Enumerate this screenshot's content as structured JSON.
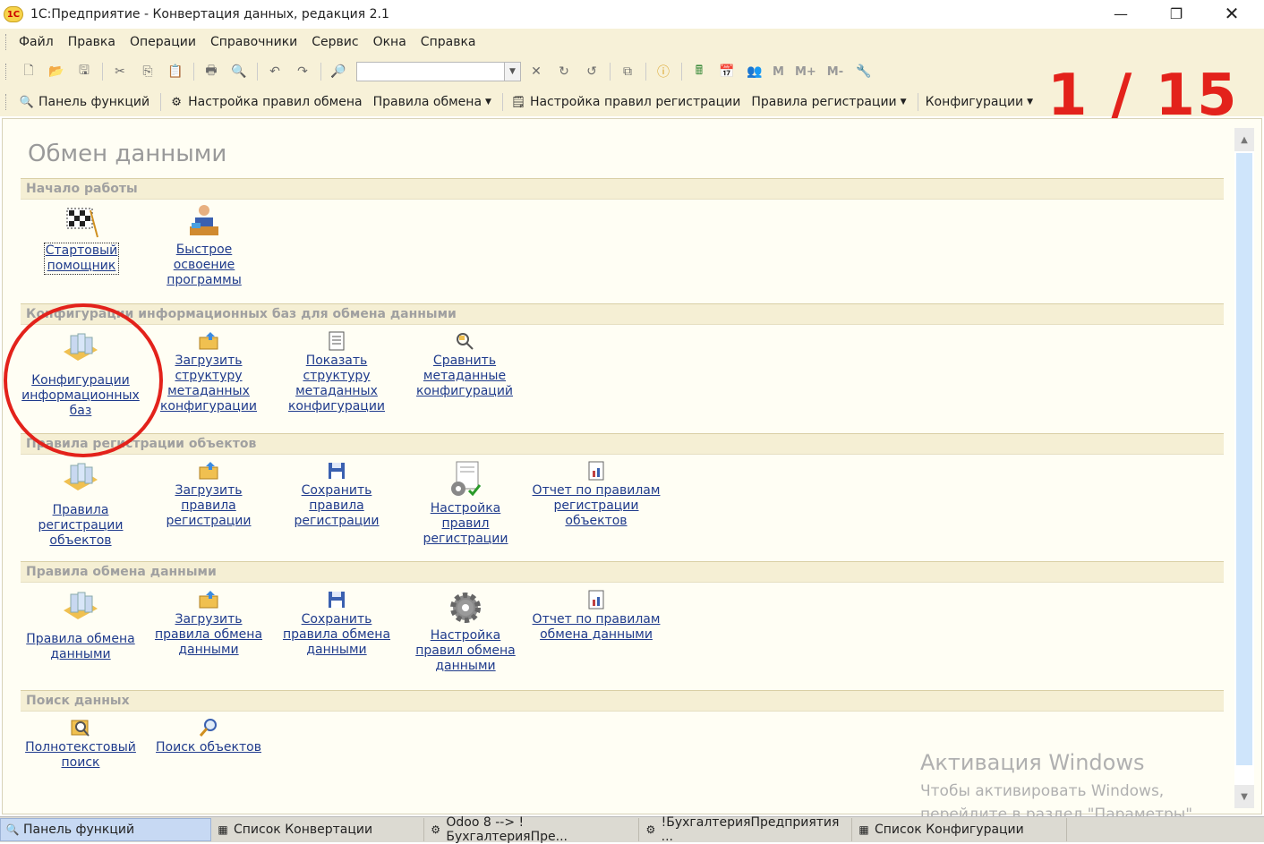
{
  "window": {
    "title": "1С:Предприятие - Конвертация данных, редакция 2.1",
    "logo": "1С"
  },
  "menu": [
    "Файл",
    "Правка",
    "Операции",
    "Справочники",
    "Сервис",
    "Окна",
    "Справка"
  ],
  "toolbar": {
    "icons": [
      "new-doc-icon",
      "open-icon",
      "save-icon",
      "cut-icon",
      "copy-icon",
      "paste-icon",
      "print-icon",
      "preview-icon",
      "undo-icon",
      "redo-icon",
      "find-icon"
    ],
    "search_value": "",
    "memory_buttons": [
      "M",
      "M+",
      "M-"
    ]
  },
  "counter": "1 / 15",
  "funcbar": {
    "panel": "Панель функций",
    "exchange_setup": "Настройка правил обмена",
    "exchange_rules": "Правила обмена",
    "registration_setup": "Настройка правил регистрации",
    "registration_rules": "Правила регистрации",
    "configurations": "Конфигурации"
  },
  "page": {
    "title": "Обмен данными",
    "sections": [
      {
        "label": "Начало работы",
        "tiles": [
          {
            "lines": [
              "Стартовый",
              "помощник"
            ],
            "icon": "checkered-flag-icon"
          },
          {
            "lines": [
              "Быстрое",
              "освоение",
              "программы"
            ],
            "icon": "teacher-icon"
          }
        ]
      },
      {
        "label": "Конфигурации информационных баз для обмена данными",
        "tiles": [
          {
            "lines": [
              "Конфигурации",
              "информационных",
              "баз"
            ],
            "icon": "database-config-icon"
          },
          {
            "lines": [
              "Загрузить",
              "структуру",
              "метаданных",
              "конфигурации"
            ],
            "icon": "load-folder-icon"
          },
          {
            "lines": [
              "Показать",
              "структуру",
              "метаданных",
              "конфигурации"
            ],
            "icon": "document-list-icon"
          },
          {
            "lines": [
              "Сравнить",
              "метаданные",
              "конфигураций"
            ],
            "icon": "compare-icon"
          }
        ]
      },
      {
        "label": "Правила регистрации объектов",
        "tiles": [
          {
            "lines": [
              "Правила",
              "регистрации",
              "объектов"
            ],
            "icon": "database-rules-icon"
          },
          {
            "lines": [
              "Загрузить",
              "правила",
              "регистрации"
            ],
            "icon": "load-folder-icon"
          },
          {
            "lines": [
              "Сохранить",
              "правила",
              "регистрации"
            ],
            "icon": "floppy-icon"
          },
          {
            "lines": [
              "Настройка",
              "правил",
              "регистрации"
            ],
            "icon": "settings-doc-icon"
          },
          {
            "lines": [
              "Отчет по правилам",
              "регистрации",
              "объектов"
            ],
            "icon": "report-icon"
          }
        ]
      },
      {
        "label": "Правила обмена данными",
        "tiles": [
          {
            "lines": [
              "Правила обмена",
              "данными"
            ],
            "icon": "database-rules-icon"
          },
          {
            "lines": [
              "Загрузить",
              "правила обмена",
              "данными"
            ],
            "icon": "load-folder-icon"
          },
          {
            "lines": [
              "Сохранить",
              "правила обмена",
              "данными"
            ],
            "icon": "floppy-icon"
          },
          {
            "lines": [
              "Настройка",
              "правил обмена",
              "данными"
            ],
            "icon": "gear-icon"
          },
          {
            "lines": [
              "Отчет по правилам",
              "обмена данными"
            ],
            "icon": "report-icon"
          }
        ]
      },
      {
        "label": "Поиск данных",
        "tiles": [
          {
            "lines": [
              "Полнотекстовый",
              "поиск"
            ],
            "icon": "fulltext-search-icon"
          },
          {
            "lines": [
              "Поиск объектов"
            ],
            "icon": "magnifier-icon"
          }
        ]
      }
    ]
  },
  "activation": {
    "title": "Активация Windows",
    "line1": "Чтобы активировать Windows,",
    "line2": "перейдите в раздел \"Параметры\"."
  },
  "taskbar": [
    "Панель функций",
    "Список Конвертации",
    "Odoo 8 --> !БухгалтерияПре...",
    "!БухгалтерияПредприятия ...",
    "Список Конфигурации"
  ],
  "colors": {
    "accent_red": "#e3221b",
    "link_blue": "#1f3b8c",
    "panel_bg": "#fffef4"
  }
}
